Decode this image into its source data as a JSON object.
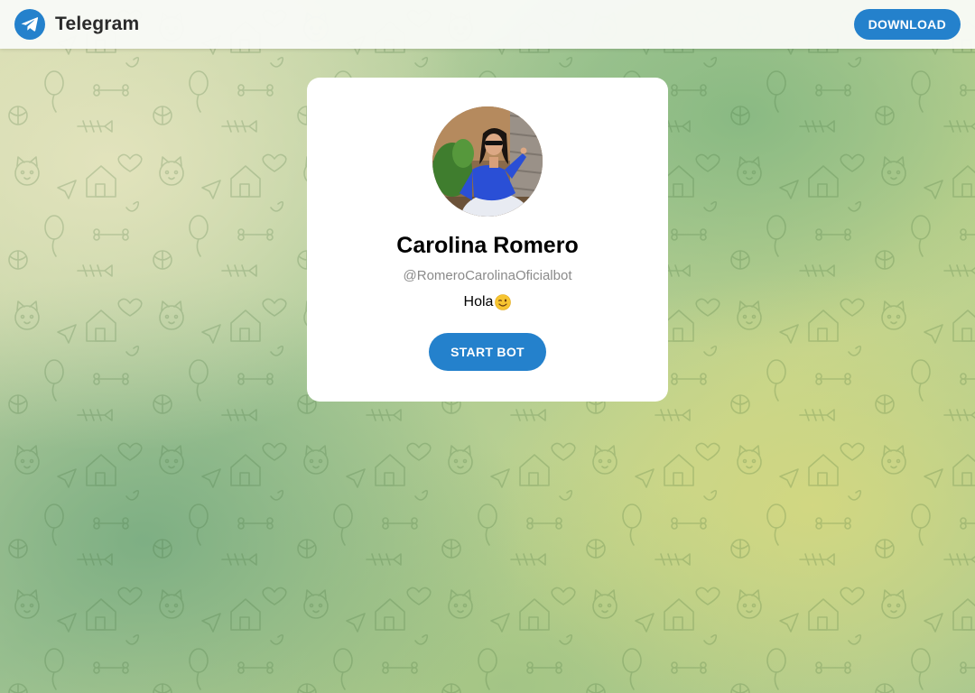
{
  "header": {
    "brand_name": "Telegram",
    "logo_icon": "telegram-plane-icon",
    "download_label": "DOWNLOAD"
  },
  "profile": {
    "name": "Carolina Romero",
    "username": "@RomeroCarolinaOficialbot",
    "bio_text": "Hola",
    "bio_emoji_icon": "winking-face-icon",
    "start_label": "START BOT"
  },
  "colors": {
    "accent": "#2481cc",
    "card_background": "#ffffff",
    "username_gray": "#8a8a8a"
  }
}
